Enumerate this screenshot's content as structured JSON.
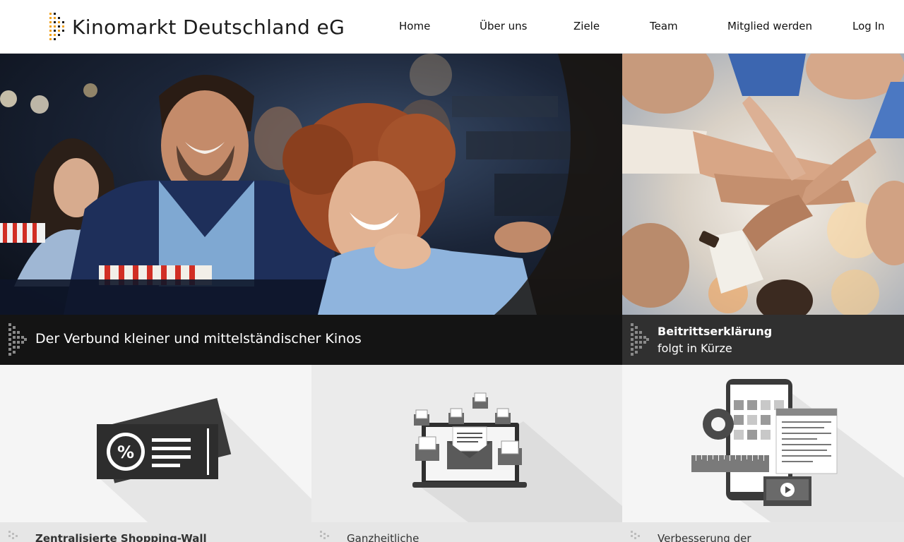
{
  "header": {
    "brand": "Kinomarkt Deutschland eG",
    "nav": [
      {
        "label": "Home"
      },
      {
        "label": "Über uns"
      },
      {
        "label": "Ziele"
      },
      {
        "label": "Team"
      },
      {
        "label": "Mitglied werden"
      },
      {
        "label": "Log In"
      }
    ]
  },
  "hero": {
    "main_caption": "Der Verbund kleiner und mittelständischer Kinos",
    "side_caption_title": "Beitrittserklärung",
    "side_caption_sub": "folgt in Kürze"
  },
  "tiles": [
    {
      "label": "Zentralisierte Shopping-Wall",
      "icon": "ticket-percent-icon"
    },
    {
      "label": "Ganzheitliche",
      "icon": "newsletter-laptop-icon"
    },
    {
      "label": "Verbesserung der",
      "icon": "mobile-app-icon"
    }
  ],
  "colors": {
    "logo_accent": "#f0a21e",
    "caption_dark": "#141414",
    "caption_side": "#303030",
    "tile_bg_light": "#f5f5f5",
    "tile_bg_mid": "#ebebeb"
  }
}
